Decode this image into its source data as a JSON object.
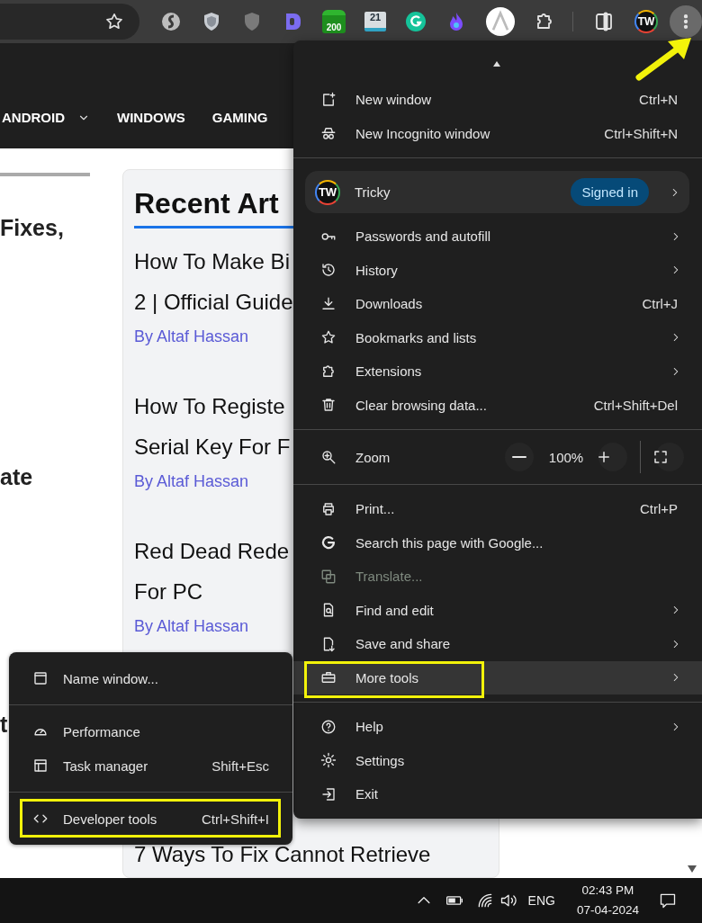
{
  "toolbar": {
    "counter_badge": "200",
    "calendar_day": "21",
    "avatar_text": "TW",
    "menu_open": true
  },
  "nav": [
    {
      "label": "ANDROID",
      "dropdown": true
    },
    {
      "label": "WINDOWS",
      "dropdown": false
    },
    {
      "label": "GAMING",
      "dropdown": false
    }
  ],
  "page": {
    "headline_fragments": [
      "Fixes,",
      "ate",
      "t"
    ],
    "sidebar": {
      "title": "Recent Art",
      "articles": [
        {
          "lines": [
            "How To Make Bi",
            "2 | Official Guide"
          ],
          "author": "By Altaf Hassan"
        },
        {
          "lines": [
            "How To Registe",
            "Serial Key For F"
          ],
          "author": "By Altaf Hassan"
        },
        {
          "lines": [
            "Red Dead Rede",
            "For PC"
          ],
          "author": "By Altaf Hassan"
        },
        {
          "lines": [
            "7 Ways To Fix Cannot Retrieve"
          ]
        }
      ]
    }
  },
  "menu": {
    "sections": [
      {
        "items": [
          {
            "kind": "item",
            "label": "New window",
            "shortcut": "Ctrl+N",
            "submenu": false,
            "disabled": false,
            "selected": false,
            "highlighted": false
          },
          {
            "kind": "item",
            "label": "New Incognito window",
            "shortcut": "Ctrl+Shift+N",
            "submenu": false,
            "disabled": false,
            "selected": false,
            "highlighted": false
          }
        ]
      },
      {
        "items": [
          {
            "kind": "profile",
            "label": "Tricky",
            "avatar_text": "TW",
            "badge": "Signed in",
            "submenu": true
          },
          {
            "kind": "item",
            "label": "Passwords and autofill",
            "submenu": true,
            "disabled": false,
            "selected": false,
            "highlighted": false
          },
          {
            "kind": "item",
            "label": "History",
            "submenu": true,
            "disabled": false,
            "selected": false,
            "highlighted": false
          },
          {
            "kind": "item",
            "label": "Downloads",
            "shortcut": "Ctrl+J",
            "submenu": false,
            "disabled": false,
            "selected": false,
            "highlighted": false
          },
          {
            "kind": "item",
            "label": "Bookmarks and lists",
            "submenu": true,
            "disabled": false,
            "selected": false,
            "highlighted": false
          },
          {
            "kind": "item",
            "label": "Extensions",
            "submenu": true,
            "disabled": false,
            "selected": false,
            "highlighted": false
          },
          {
            "kind": "item",
            "label": "Clear browsing data...",
            "shortcut": "Ctrl+Shift+Del",
            "submenu": false,
            "disabled": false,
            "selected": false,
            "highlighted": false
          }
        ]
      },
      {
        "items": [
          {
            "kind": "zoom",
            "label": "Zoom",
            "value": "100%"
          }
        ]
      },
      {
        "items": [
          {
            "kind": "item",
            "label": "Print...",
            "shortcut": "Ctrl+P",
            "submenu": false,
            "disabled": false,
            "selected": false,
            "highlighted": false
          },
          {
            "kind": "item",
            "label": "Search this page with Google...",
            "submenu": false,
            "disabled": false,
            "selected": false,
            "highlighted": false
          },
          {
            "kind": "item",
            "label": "Translate...",
            "submenu": false,
            "disabled": true,
            "selected": false,
            "highlighted": false
          },
          {
            "kind": "item",
            "label": "Find and edit",
            "submenu": true,
            "disabled": false,
            "selected": false,
            "highlighted": false
          },
          {
            "kind": "item",
            "label": "Save and share",
            "submenu": true,
            "disabled": false,
            "selected": false,
            "highlighted": false
          },
          {
            "kind": "item",
            "label": "More tools",
            "submenu": true,
            "disabled": false,
            "selected": true,
            "highlighted": true
          }
        ]
      },
      {
        "items": [
          {
            "kind": "item",
            "label": "Help",
            "submenu": true,
            "disabled": false,
            "selected": false,
            "highlighted": false
          },
          {
            "kind": "item",
            "label": "Settings",
            "submenu": false,
            "disabled": false,
            "selected": false,
            "highlighted": false
          },
          {
            "kind": "item",
            "label": "Exit",
            "submenu": false,
            "disabled": false,
            "selected": false,
            "highlighted": false
          }
        ]
      }
    ]
  },
  "submenu": {
    "sections": [
      {
        "items": [
          {
            "kind": "item",
            "label": "Name window...",
            "submenu": false,
            "disabled": false,
            "selected": false,
            "highlighted": false
          }
        ]
      },
      {
        "items": [
          {
            "kind": "item",
            "label": "Performance",
            "submenu": false,
            "disabled": false,
            "selected": false,
            "highlighted": false
          },
          {
            "kind": "item",
            "label": "Task manager",
            "shortcut": "Shift+Esc",
            "submenu": false,
            "disabled": false,
            "selected": false,
            "highlighted": false
          }
        ]
      },
      {
        "items": [
          {
            "kind": "item",
            "label": "Developer tools",
            "shortcut": "Ctrl+Shift+I",
            "submenu": false,
            "disabled": false,
            "selected": false,
            "highlighted": true
          }
        ]
      }
    ]
  },
  "taskbar": {
    "language": "ENG",
    "time": "02:43 PM",
    "date": "07-04-2024"
  }
}
